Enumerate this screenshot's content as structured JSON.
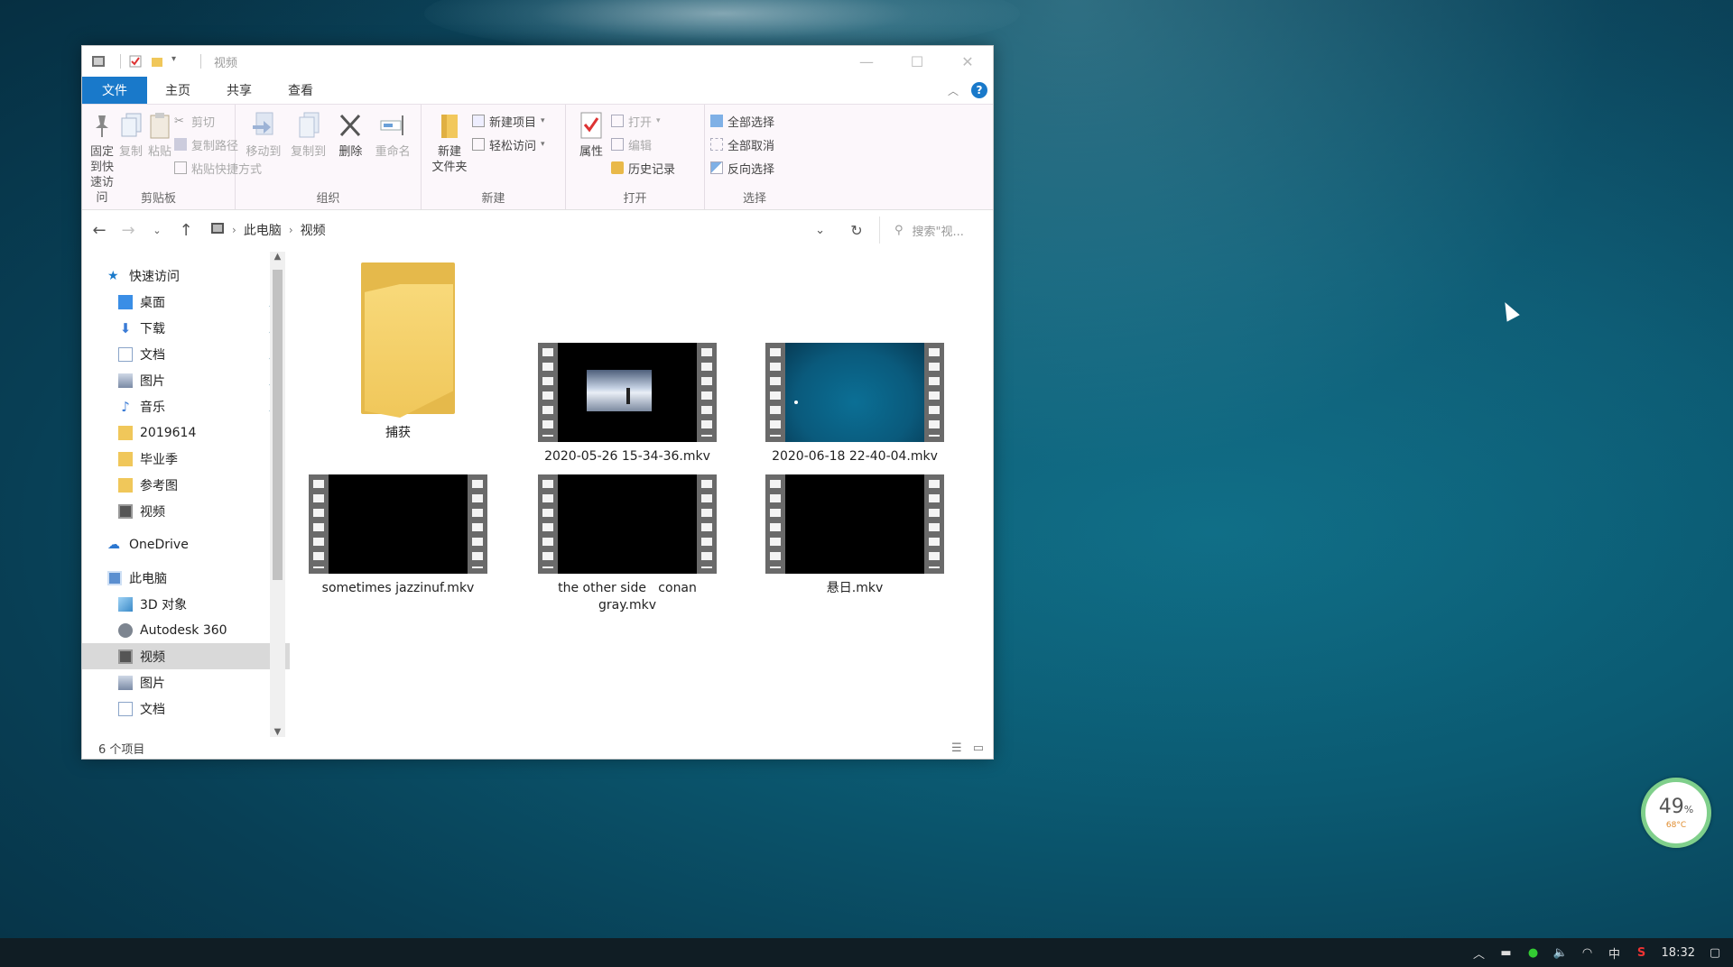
{
  "window": {
    "title": "视频",
    "tabs": [
      "文件",
      "主页",
      "共享",
      "查看"
    ]
  },
  "ribbon": {
    "clipboard": {
      "label": "剪贴板",
      "pin": "固定到快\n速访问",
      "copy": "复制",
      "paste": "粘贴",
      "cut": "剪切",
      "copy_path": "复制路径",
      "paste_shortcut": "粘贴快捷方式"
    },
    "organize": {
      "label": "组织",
      "move_to": "移动到",
      "copy_to": "复制到",
      "delete": "删除",
      "rename": "重命名"
    },
    "new": {
      "label": "新建",
      "new_folder": "新建\n文件夹",
      "new_item": "新建项目",
      "easy_access": "轻松访问"
    },
    "open": {
      "label": "打开",
      "properties": "属性",
      "open": "打开",
      "edit": "编辑",
      "history": "历史记录"
    },
    "select": {
      "label": "选择",
      "select_all": "全部选择",
      "select_none": "全部取消",
      "invert": "反向选择"
    }
  },
  "address": {
    "crumbs": [
      "此电脑",
      "视频"
    ],
    "search_placeholder": "搜索\"视..."
  },
  "nav": {
    "quick_access": "快速访问",
    "quick_items": [
      "桌面",
      "下载",
      "文档",
      "图片",
      "音乐",
      "2019614",
      "毕业季",
      "参考图",
      "视频"
    ],
    "onedrive": "OneDrive",
    "this_pc": "此电脑",
    "pc_items": [
      "3D 对象",
      "Autodesk 360",
      "视频",
      "图片",
      "文档"
    ]
  },
  "files": [
    {
      "name": "捕获",
      "kind": "folder"
    },
    {
      "name": "2020-05-26 15-34-36.mkv",
      "kind": "video-sky"
    },
    {
      "name": "2020-06-18 22-40-04.mkv",
      "kind": "video-sea"
    },
    {
      "name": "sometimes jazzinuf.mkv",
      "kind": "video-black"
    },
    {
      "name": "the other side   conan gray.mkv",
      "kind": "video-black"
    },
    {
      "name": "悬日.mkv",
      "kind": "video-black"
    }
  ],
  "status": {
    "item_count": "6 个项目"
  },
  "widget": {
    "percent": "49",
    "percent_sign": "%",
    "temp": "68°C"
  },
  "taskbar": {
    "ime": "中",
    "time": "18:32"
  },
  "colors": {
    "accent": "#1979ca",
    "ribbon_bg": "#fcf7fb",
    "folder": "#f0c75a"
  }
}
